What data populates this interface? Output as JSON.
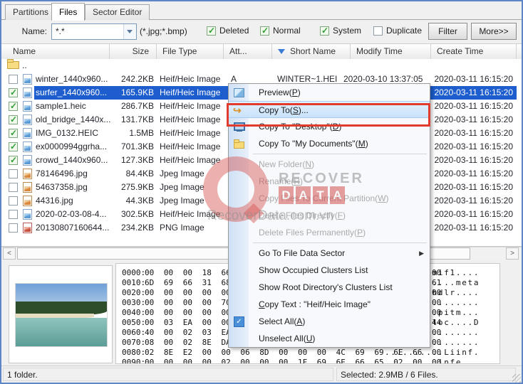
{
  "tabs": [
    {
      "label": "Partitions",
      "active": false
    },
    {
      "label": "Files",
      "active": true
    },
    {
      "label": "Sector Editor",
      "active": false
    }
  ],
  "filter_bar": {
    "name_label": "Name:",
    "name_value": "*.*",
    "pattern_hint": "(*.jpg;*.bmp)",
    "checkboxes": [
      {
        "label": "Deleted",
        "checked": true
      },
      {
        "label": "Normal",
        "checked": true
      },
      {
        "label": "System",
        "checked": true
      },
      {
        "label": "Duplicate",
        "checked": false
      }
    ],
    "filter_button": "Filter",
    "more_button": "More>>"
  },
  "table": {
    "columns": [
      "Name",
      "Size",
      "File Type",
      "Att...",
      "Short Name",
      "Modify Time",
      "Create Time"
    ],
    "parent_row": {
      "name": ".."
    },
    "rows": [
      {
        "name": "winter_1440x960...",
        "size": "242.2KB",
        "type": "Heif/Heic Image",
        "att": "A",
        "short": "WINTER~1.HEI",
        "modify": "2020-03-10 13:37:05",
        "create": "2020-03-11 16:15:20",
        "checked": false,
        "selected": false,
        "icon": "heic"
      },
      {
        "name": "surfer_1440x960...",
        "size": "165.9KB",
        "type": "Heif/Heic Image",
        "att": "",
        "short": "",
        "modify": "",
        "create": "2020-03-11 16:15:20",
        "checked": true,
        "selected": true,
        "icon": "heic"
      },
      {
        "name": "sample1.heic",
        "size": "286.7KB",
        "type": "Heif/Heic Image",
        "att": "",
        "short": "",
        "modify": "",
        "create": "2020-03-11 16:15:20",
        "checked": true,
        "selected": false,
        "icon": "heic"
      },
      {
        "name": "old_bridge_1440x...",
        "size": "131.7KB",
        "type": "Heif/Heic Image",
        "att": "",
        "short": "",
        "modify": "",
        "create": "2020-03-11 16:15:20",
        "checked": true,
        "selected": false,
        "icon": "heic"
      },
      {
        "name": "IMG_0132.HEIC",
        "size": "1.5MB",
        "type": "Heif/Heic Image",
        "att": "",
        "short": "",
        "modify": "",
        "create": "2020-03-11 16:15:20",
        "checked": true,
        "selected": false,
        "icon": "heic"
      },
      {
        "name": "ex0000994ggrha...",
        "size": "701.3KB",
        "type": "Heif/Heic Image",
        "att": "",
        "short": "",
        "modify": "",
        "create": "2020-03-11 16:15:20",
        "checked": true,
        "selected": false,
        "icon": "heic"
      },
      {
        "name": "crowd_1440x960...",
        "size": "127.3KB",
        "type": "Heif/Heic Image",
        "att": "",
        "short": "",
        "modify": "",
        "create": "2020-03-11 16:15:20",
        "checked": true,
        "selected": false,
        "icon": "heic"
      },
      {
        "name": "78146496.jpg",
        "size": "84.4KB",
        "type": "Jpeg Image",
        "att": "",
        "short": "",
        "modify": "",
        "create": "2020-03-11 16:15:20",
        "checked": false,
        "selected": false,
        "icon": "jpg"
      },
      {
        "name": "54637358.jpg",
        "size": "275.9KB",
        "type": "Jpeg Image",
        "att": "",
        "short": "",
        "modify": "",
        "create": "2020-03-11 16:15:20",
        "checked": false,
        "selected": false,
        "icon": "jpg"
      },
      {
        "name": "44316.jpg",
        "size": "44.3KB",
        "type": "Jpeg Image",
        "att": "",
        "short": "",
        "modify": "",
        "create": "2020-03-11 16:15:20",
        "checked": false,
        "selected": false,
        "icon": "jpg"
      },
      {
        "name": "2020-02-03-08-4...",
        "size": "302.5KB",
        "type": "Heif/Heic Image",
        "att": "",
        "short": "",
        "modify": "",
        "create": "2020-03-11 16:15:20",
        "checked": false,
        "selected": false,
        "icon": "heic"
      },
      {
        "name": "20130807160644...",
        "size": "234.2KB",
        "type": "PNG Image",
        "att": "",
        "short": "",
        "modify": "",
        "create": "2020-03-11 16:15:20",
        "checked": false,
        "selected": false,
        "icon": "png"
      }
    ]
  },
  "context_menu": {
    "items": [
      {
        "id": "preview",
        "icon": "mi-preview",
        "pre": "Preview(",
        "key": "P",
        "post": ")"
      },
      {
        "id": "copy-to",
        "icon": "mi-copyto",
        "icon_glyph": "↪",
        "pre": "Copy To(",
        "key": "S",
        "post": ")...",
        "highlight": true
      },
      {
        "id": "copy-to-desktop",
        "icon": "mi-desktop",
        "pre": "Copy To \"Desktop\"(",
        "key": "D",
        "post": ")"
      },
      {
        "id": "copy-to-my-documents",
        "icon": "mi-mydocs",
        "pre": "Copy To \"My Documents\"(",
        "key": "M",
        "post": ")"
      },
      {
        "type": "separator"
      },
      {
        "id": "new-folder",
        "pre": "New Folder(",
        "key": "N",
        "post": ")",
        "disabled": true
      },
      {
        "id": "rename",
        "pre": "Rename(",
        "key": "R",
        "post": ")",
        "disabled": true
      },
      {
        "id": "copy-files-to-current-partition",
        "pre": "Copy Files To Current Partition(",
        "key": "W",
        "post": ")",
        "disabled": true
      },
      {
        "id": "delete-files-directly",
        "pre": "Delete Files Directly(",
        "key": "F",
        "post": ")",
        "disabled": true
      },
      {
        "id": "delete-files-permanently",
        "pre": "Delete Files Permanently(",
        "key": "P",
        "post": ")",
        "disabled": true
      },
      {
        "type": "separator"
      },
      {
        "id": "go-to-file-data-sector",
        "pre": "Go To File Data Sector",
        "key": "",
        "post": "",
        "submenu": true
      },
      {
        "id": "show-occupied-clusters-list",
        "pre": "Show Occupied Clusters List",
        "key": "",
        "post": ""
      },
      {
        "id": "show-root-directorys-clusters-list",
        "pre": "Show Root Directory's Clusters List",
        "key": "",
        "post": ""
      },
      {
        "id": "copy-text",
        "pre": "",
        "key": "C",
        "post": "opy Text : \"Heif/Heic Image\""
      },
      {
        "id": "select-all",
        "icon": "mi-selectall",
        "pre": "Select All(",
        "key": "A",
        "post": ")"
      },
      {
        "id": "unselect-all",
        "pre": "Unselect All(",
        "key": "U",
        "post": ")"
      }
    ]
  },
  "hex_view": {
    "rows": [
      {
        "offset": "0000:",
        "bytes": "00 00 00 18 66 74 79 70 6D 69 66 31 00 00 00 00",
        "ascii": "....ftypmif1...."
      },
      {
        "offset": "0010:",
        "bytes": "6D 69 66 31 68 65 69 63 00 00 0B 1D 6D 65 74 61",
        "ascii": "mif1heic....meta"
      },
      {
        "offset": "0020:",
        "bytes": "00 00 00 00 00 00 00 21 68 64 6C 72 00 00 00 00",
        "ascii": ".......!hdlr...."
      },
      {
        "offset": "0030:",
        "bytes": "00 00 00 00 70 69 63 74 00 00 00 00 00 00 00 00",
        "ascii": "....pict........"
      },
      {
        "offset": "0040:",
        "bytes": "00 00 00 00 00 00 00 00 00 70 69 74 6D 00 00 00",
        "ascii": ".........pitm..."
      },
      {
        "offset": "0050:",
        "bytes": "00 03 EA 00 00 00 00 69 6C 6F 63 00 00 00 00 44",
        "ascii": ".......iloc....D"
      },
      {
        "offset": "0060:",
        "bytes": "40 00 02 03 EA 00 00 00 00 00 00 00 00 00 00 00",
        "ascii": "@..............."
      },
      {
        "offset": "0070:",
        "bytes": "08 00 02 8E DA 03 ED 00 00 00 00 02 16 00 01 00",
        "ascii": "................"
      },
      {
        "offset": "0080:",
        "bytes": "02 8E E2 00 00 06 8D 00 00 00 4C 69 69 6E 66 00",
        "ascii": "..........Liinf."
      },
      {
        "offset": "0090:",
        "bytes": "00 00 00 00 02 00 00 00 1F 69 6E 66 65 02 00 00",
        "ascii": ".........infe..."
      }
    ]
  },
  "status_bar": {
    "left": "1 folder.",
    "right": "Selected: 2.9MB / 6 Files."
  },
  "watermark": {
    "line1": "RECOVER",
    "letters": [
      "D",
      "A",
      "T",
      "A"
    ],
    "url": "RecoverData.com.vn"
  }
}
